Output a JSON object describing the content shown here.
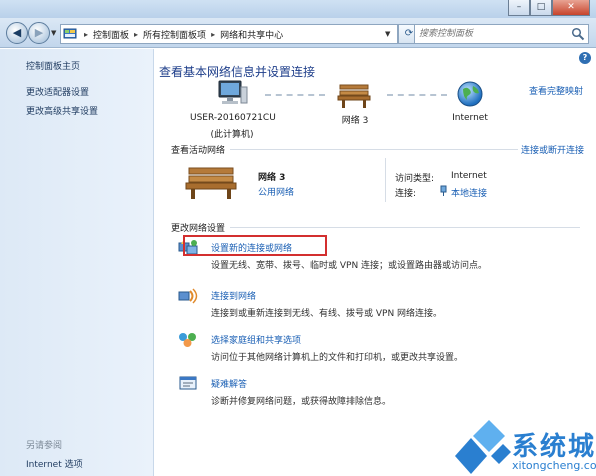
{
  "window": {
    "minimize": "–",
    "maximize": "□",
    "close": "✕"
  },
  "address": {
    "crumbs": [
      "控制面板",
      "所有控制面板项",
      "网络和共享中心"
    ],
    "search_placeholder": "搜索控制面板"
  },
  "left_pane": {
    "home": "控制面板主页",
    "links": [
      "更改适配器设置",
      "更改高级共享设置"
    ],
    "see_also_header": "另请参阅",
    "see_also": [
      "Internet 选项"
    ]
  },
  "main": {
    "title": "查看基本网络信息并设置连接",
    "full_map_link": "查看完整映射",
    "map": {
      "computer_name": "USER-20160721CU",
      "computer_sub": "(此计算机)",
      "network": "网络  3",
      "internet": "Internet"
    },
    "active_networks": {
      "header": "查看活动网络",
      "connect_link": "连接或断开连接",
      "name": "网络  3",
      "type": "公用网络",
      "access_type_label": "访问类型:",
      "access_type_value": "Internet",
      "connections_label": "连接:",
      "connections_value": "本地连接"
    },
    "change_settings": {
      "header": "更改网络设置",
      "tasks": [
        {
          "link": "设置新的连接或网络",
          "desc": "设置无线、宽带、拨号、临时或 VPN 连接；或设置路由器或访问点。"
        },
        {
          "link": "连接到网络",
          "desc": "连接到或重新连接到无线、有线、拨号或 VPN 网络连接。"
        },
        {
          "link": "选择家庭组和共享选项",
          "desc": "访问位于其他网络计算机上的文件和打印机，或更改共享设置。"
        },
        {
          "link": "疑难解答",
          "desc": "诊断并修复网络问题，或获得故障排除信息。"
        }
      ]
    },
    "help": "?"
  },
  "watermark": {
    "brand": "系统城",
    "url": "xitongcheng.com"
  },
  "colors": {
    "link": "#1a5fb4",
    "title": "#1e3e8a",
    "highlight": "#d32f2f",
    "pane": "#dde9f6"
  }
}
